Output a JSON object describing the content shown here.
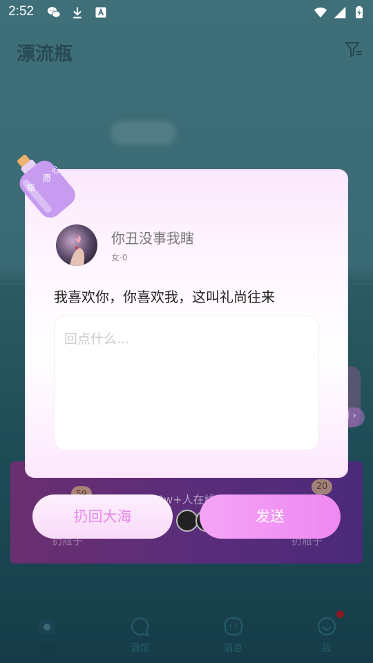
{
  "status_bar": {
    "time": "2:52"
  },
  "header": {
    "title": "漂流瓶"
  },
  "background": {
    "online_text": "0w+人在线",
    "left_badge": "59",
    "right_badge": "20",
    "left_label": "扔瓶子",
    "right_label": "扔瓶子",
    "side_pill_text": "l ›"
  },
  "modal": {
    "bottle_tag": {
      "line1": "心",
      "line2": "愿",
      "line3": "瓶"
    },
    "user": {
      "name": "你丑没事我瞎",
      "sub": "女·0"
    },
    "message": "我喜欢你，你喜欢我，这叫礼尚往来",
    "reply": {
      "placeholder": "回点什么...",
      "value": ""
    },
    "return_button": "扔回大海",
    "send_button": "发送"
  },
  "nav": {
    "items": [
      {
        "label": "首页",
        "icon": "home-icon",
        "active": true
      },
      {
        "label": "酒馆",
        "icon": "chat-bubble-icon",
        "active": false
      },
      {
        "label": "消息",
        "icon": "message-face-icon",
        "active": false
      },
      {
        "label": "我",
        "icon": "smile-face-icon",
        "active": false
      }
    ]
  },
  "colors": {
    "accent": "#ee88f2",
    "accent_light": "#f9dbf9",
    "sea": "#1e4c56",
    "notification_dot": "#8a1a24"
  }
}
